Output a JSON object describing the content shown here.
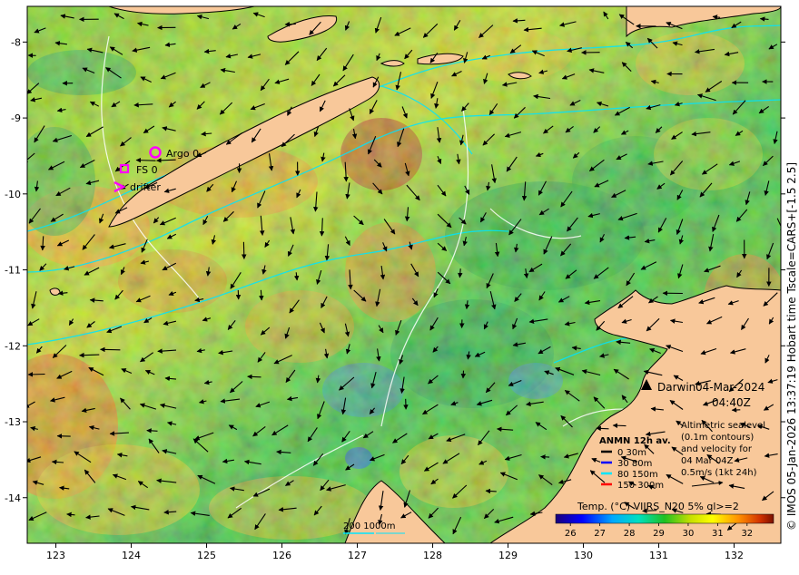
{
  "axes": {
    "x_ticks": [
      "123",
      "124",
      "125",
      "126",
      "127",
      "128",
      "129",
      "130",
      "131",
      "132"
    ],
    "x_values": [
      123,
      124,
      125,
      126,
      127,
      128,
      129,
      130,
      131,
      132
    ],
    "y_ticks": [
      "-8",
      "-9",
      "-10",
      "-11",
      "-12",
      "-13",
      "-14"
    ],
    "y_values": [
      -8,
      -9,
      -10,
      -11,
      -12,
      -13,
      -14
    ],
    "lon_range": [
      122.62,
      132.62
    ],
    "lat_range": [
      -14.6,
      -7.53
    ]
  },
  "legend_platforms": {
    "argo": "Argo 0",
    "fs": "FS 0",
    "drifter": "drifter"
  },
  "station": {
    "name": "Darwin",
    "date": "04-Mar-2024",
    "time": "04:40Z"
  },
  "anmn": {
    "title": "ANMN 12h av.",
    "items": [
      {
        "label": "0 30m",
        "color": "#000000"
      },
      {
        "label": "30 80m",
        "color": "#0000ff"
      },
      {
        "label": "80 150m",
        "color": "#00e5ff"
      },
      {
        "label": "150 300m",
        "color": "#ff0000"
      }
    ]
  },
  "altimetry": {
    "lines": [
      "Altimetric sealevel",
      "(0.1m contours)",
      "and velocity for",
      "04 Mar 04Z",
      "0.5m/s (1kt 24h)"
    ]
  },
  "isobath": {
    "label": "200  1000m"
  },
  "colorbar": {
    "title": "Temp. (°C) VIIRS_N20 5% ql>=2",
    "ticks": [
      "26",
      "27",
      "28",
      "29",
      "30",
      "31",
      "32"
    ],
    "tick_values": [
      26,
      27,
      28,
      29,
      30,
      31,
      32
    ],
    "range": [
      25.5,
      32.9
    ]
  },
  "credit": "© IMOS 05-Jan-2026 13:37:19 Hobart time Tscale=CARS+[-1.5 2.5]",
  "colors": {
    "land": "#f8c89a",
    "platform_marker": "#ff00ff",
    "isobath": "#00e5ff",
    "ssh_contour": "#ffffff"
  }
}
